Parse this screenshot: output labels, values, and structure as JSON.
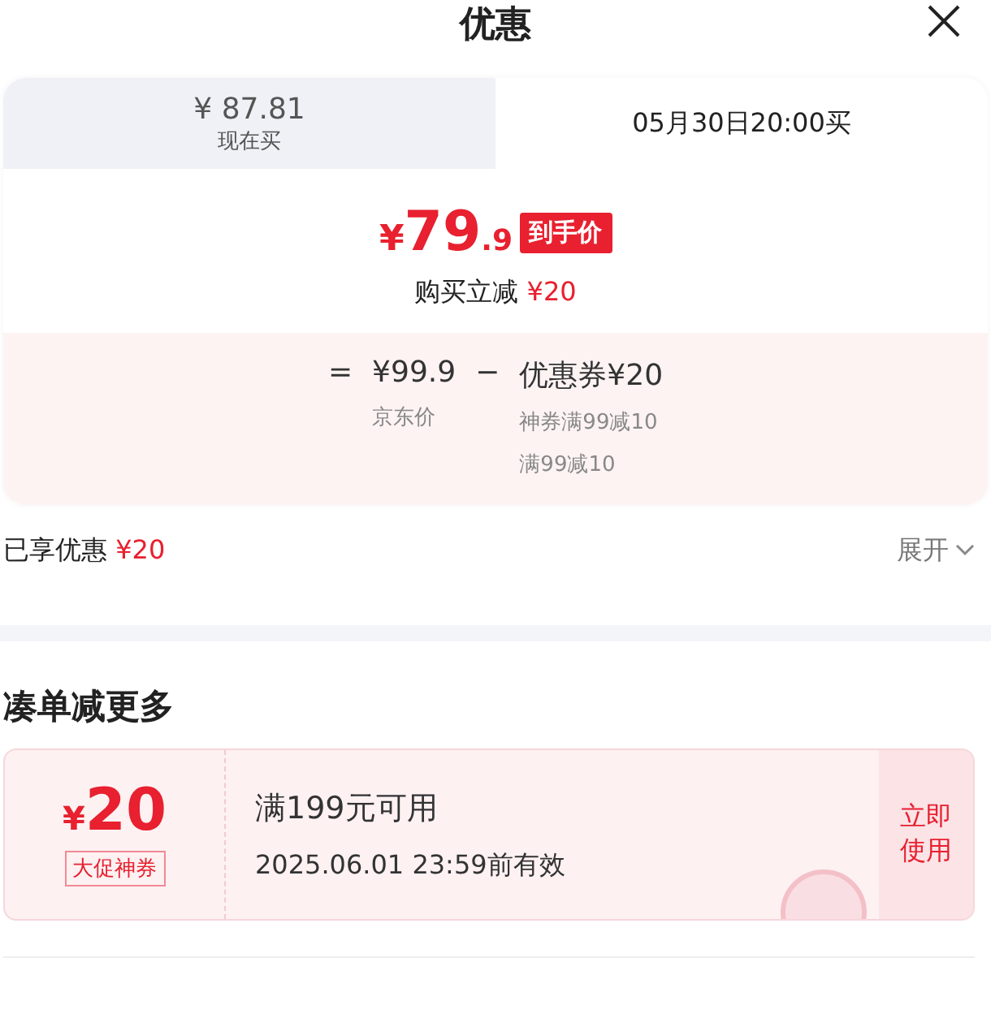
{
  "title": "优惠",
  "tabs": [
    {
      "price": "¥ 87.81",
      "label": "现在买",
      "selected": false
    },
    {
      "label": "05月30日20:00买",
      "selected": true
    }
  ],
  "final_price": {
    "currency": "¥",
    "integer": "79",
    "decimal": ".9",
    "badge": "到手价",
    "saving_label": "购买立减",
    "saving": "¥20"
  },
  "breakdown": {
    "equals": "=",
    "base_price": "¥99.9",
    "base_label": "京东价",
    "minus": "−",
    "coupon_label": "优惠券¥20",
    "coupon_items": [
      "神券满99减10",
      "满99减10"
    ]
  },
  "enjoyed": {
    "label": "已享优惠",
    "amount": "¥20",
    "expand": "展开"
  },
  "more_section": {
    "heading": "凑单减更多"
  },
  "coupons": [
    {
      "currency": "¥",
      "amount": "20",
      "tag": "大促神券",
      "condition": "满199元可用",
      "validity": "2025.06.01 23:59前有效",
      "action": "立即使用",
      "claimed": true
    }
  ]
}
